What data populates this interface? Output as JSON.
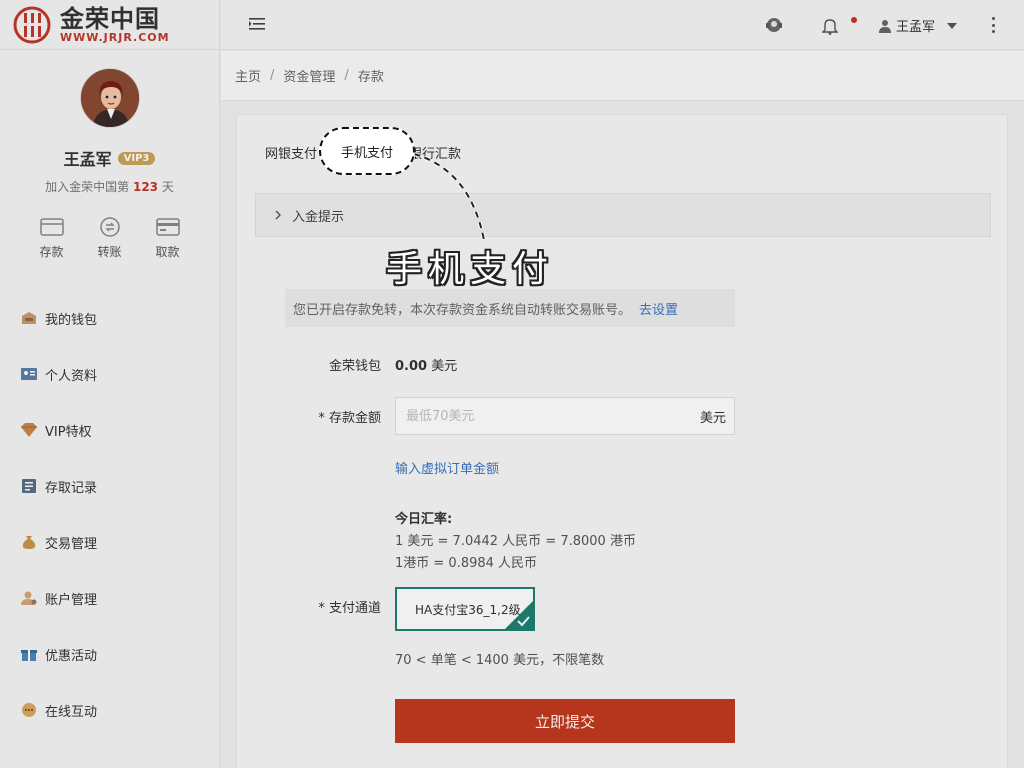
{
  "brand": {
    "name": "金荣中国",
    "url": "WWW.JRJR.COM",
    "color": "#c0392b"
  },
  "profile": {
    "name": "王孟军",
    "vip": "VIP3",
    "join_prefix": "加入金荣中国第",
    "join_days": "123",
    "join_suffix": "天"
  },
  "quick_actions": [
    {
      "label": "存款",
      "icon": "deposit-card-icon"
    },
    {
      "label": "转账",
      "icon": "transfer-icon"
    },
    {
      "label": "取款",
      "icon": "withdraw-card-icon"
    }
  ],
  "menu": [
    {
      "label": "我的钱包",
      "icon": "wallet-icon"
    },
    {
      "label": "个人资料",
      "icon": "id-card-icon"
    },
    {
      "label": "VIP特权",
      "icon": "diamond-icon"
    },
    {
      "label": "存取记录",
      "icon": "records-icon"
    },
    {
      "label": "交易管理",
      "icon": "money-bag-icon"
    },
    {
      "label": "账户管理",
      "icon": "user-settings-icon"
    },
    {
      "label": "优惠活动",
      "icon": "gift-icon"
    },
    {
      "label": "在线互动",
      "icon": "chat-icon"
    }
  ],
  "header": {
    "user_name": "王孟军"
  },
  "breadcrumb": [
    "主页",
    "资金管理",
    "存款"
  ],
  "tabs": {
    "online_bank": "网银支付",
    "mobile_pay": "手机支付",
    "bank_transfer": "银行汇款"
  },
  "tip_panel": {
    "label": "入金提示"
  },
  "annotation": {
    "text": "手机支付"
  },
  "notice": {
    "text": "您已开启存款免转，本次存款资金系统自动转账交易账号。",
    "link": "去设置"
  },
  "form": {
    "wallet_label": "金荣钱包",
    "wallet_amount": "0.00",
    "wallet_unit": "美元",
    "amount_label": "* 存款金额",
    "amount_placeholder": "最低70美元",
    "amount_unit": "美元",
    "virtual_link": "输入虚拟订单金额",
    "rate_title": "今日汇率:",
    "rate_line1": "1 美元 = 7.0442 人民币 = 7.8000 港币",
    "rate_line2": "1港币 = 0.8984 人民币",
    "channel_label": "* 支付通道",
    "channel_value": "HA支付宝36_1,2级",
    "limit_text": "70 < 单笔 < 1400 美元，不限笔数",
    "submit_label": "立即提交"
  },
  "colors": {
    "accent": "#c23a1f",
    "link": "#3a76c4",
    "channel": "#1f8070",
    "vip": "#c9a45c"
  }
}
